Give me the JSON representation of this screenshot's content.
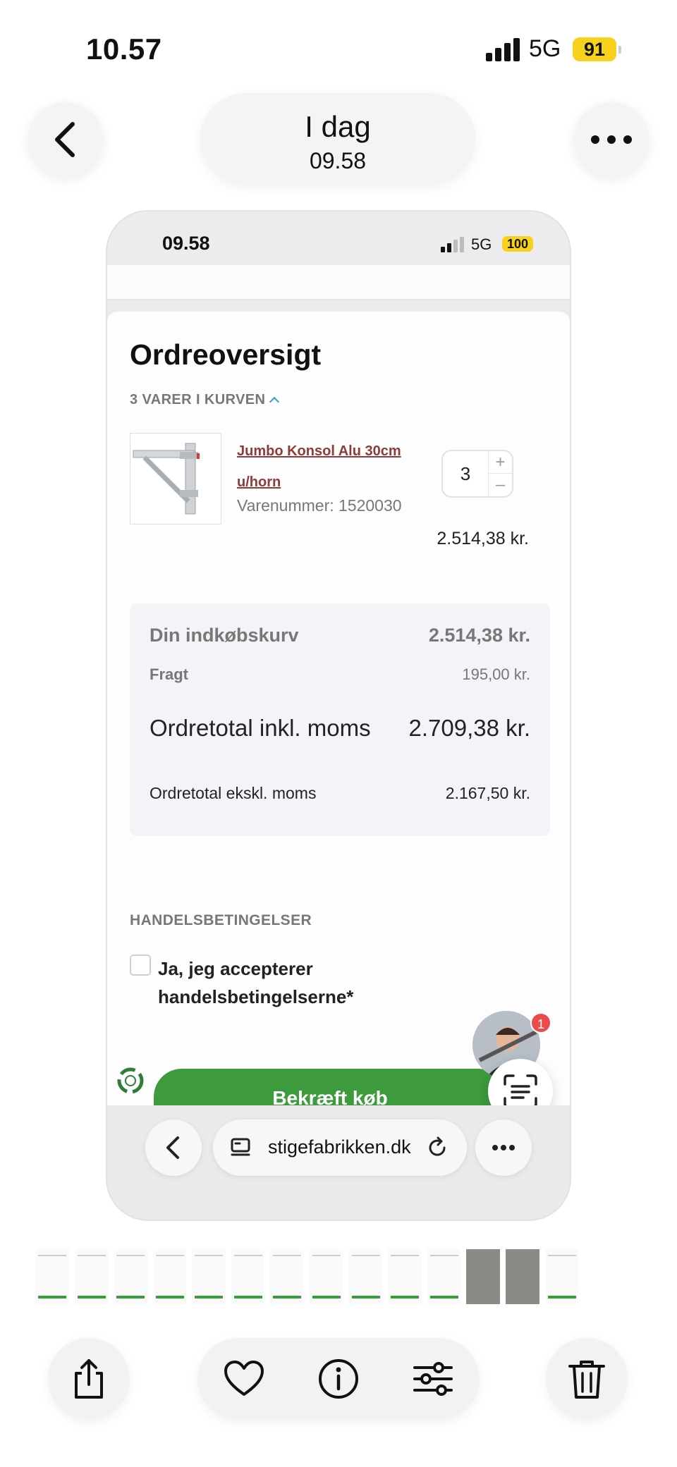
{
  "outer_status": {
    "time": "10.57",
    "network": "5G",
    "battery": "91"
  },
  "viewer": {
    "title_day": "I dag",
    "title_time": "09.58"
  },
  "inner_status": {
    "time": "09.58",
    "network": "5G",
    "battery": "100"
  },
  "order": {
    "heading": "Ordreoversigt",
    "items_count": "3 VARER I KURVEN",
    "item": {
      "name": "Jumbo Konsol Alu 30cm u/horn",
      "sku": "Varenummer: 1520030",
      "quantity": "3",
      "plus": "+",
      "minus": "–",
      "price": "2.514,38 kr."
    },
    "summary": {
      "cart_label": "Din indkøbskurv",
      "cart_value": "2.514,38 kr.",
      "shipping_label": "Fragt",
      "shipping_value": "195,00 kr.",
      "total_incl_label": "Ordretotal inkl. moms",
      "total_incl_value": "2.709,38 kr.",
      "total_excl_label": "Ordretotal ekskl. moms",
      "total_excl_value": "2.167,50 kr."
    },
    "terms_heading": "HANDELSBETINGELSER",
    "terms_label": "Ja, jeg accepterer handelsbetingelserne*",
    "confirm_button": "Bekræft køb",
    "chat_badge": "1"
  },
  "browser": {
    "url": "stigefabrikken.dk"
  },
  "colors": {
    "accent_green": "#3d9a3d",
    "link_red": "#8d3b3b",
    "battery_yellow": "#f7d21c",
    "badge_red": "#ec4b4b"
  },
  "icons": [
    "back-chevron-icon",
    "more-dots-icon",
    "tabs-icon",
    "reload-icon",
    "share-icon",
    "heart-icon",
    "info-icon",
    "sliders-icon",
    "trash-icon",
    "scan-text-icon",
    "recycle-icon"
  ]
}
